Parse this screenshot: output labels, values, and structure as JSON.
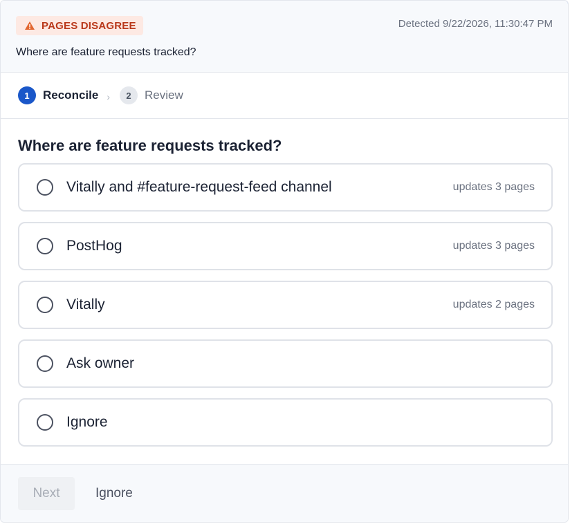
{
  "header": {
    "badge_label": "PAGES DISAGREE",
    "badge_icon": "warning-icon",
    "detected": "Detected 9/22/2026, 11:30:47 PM",
    "question": "Where are feature requests tracked?"
  },
  "steps": [
    {
      "number": "1",
      "label": "Reconcile",
      "active": true
    },
    {
      "number": "2",
      "label": "Review",
      "active": false
    }
  ],
  "main": {
    "question": "Where are feature requests tracked?",
    "options": [
      {
        "label": "Vitally and #feature-request-feed channel",
        "meta": "updates 3 pages"
      },
      {
        "label": "PostHog",
        "meta": "updates 3 pages"
      },
      {
        "label": "Vitally",
        "meta": "updates 2 pages"
      },
      {
        "label": "Ask owner",
        "meta": ""
      },
      {
        "label": "Ignore",
        "meta": ""
      }
    ]
  },
  "footer": {
    "next_label": "Next",
    "ignore_label": "Ignore"
  },
  "colors": {
    "accent": "#1a57c9",
    "badge_bg": "#fde9e3",
    "badge_text": "#b9381a",
    "warning_icon": "#e2662f"
  }
}
